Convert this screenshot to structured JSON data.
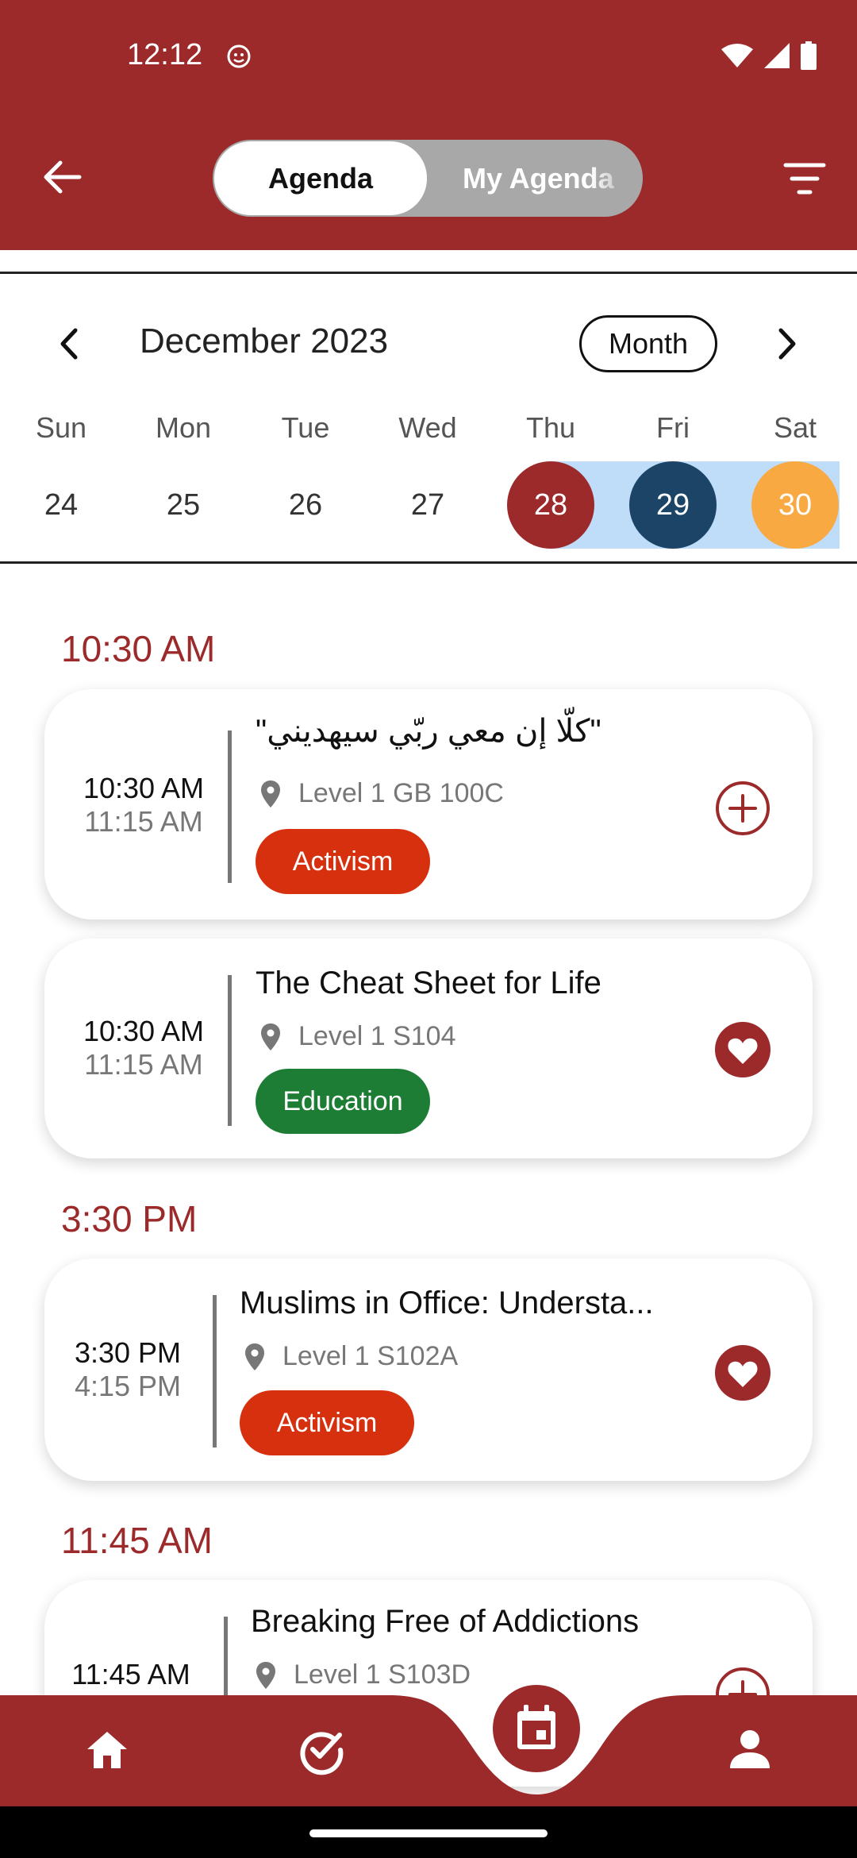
{
  "status_bar": {
    "time": "12:12"
  },
  "header": {
    "segment_active": "Agenda",
    "segment_inactive": "My Agenda"
  },
  "calendar": {
    "title": "December 2023",
    "view_button": "Month",
    "weekdays": [
      "Sun",
      "Mon",
      "Tue",
      "Wed",
      "Thu",
      "Fri",
      "Sat"
    ],
    "days": [
      "24",
      "25",
      "26",
      "27",
      "28",
      "29",
      "30"
    ],
    "colors": {
      "thu": "#9c2a2b",
      "fri": "#1b4466",
      "sat": "#f9a942",
      "range": "#bfdcf9"
    }
  },
  "sections": [
    {
      "heading": "10:30 AM"
    },
    {
      "heading": "3:30 PM"
    },
    {
      "heading": "11:45 AM"
    }
  ],
  "sessions": [
    {
      "start": "10:30 AM",
      "end": "11:15 AM",
      "title": "\"كلّا إن معي ربّي سيهديني\"",
      "location": "Level 1 GB 100C",
      "tag": "Activism",
      "tag_color": "#d6300f",
      "action_icon": "add-circle-icon"
    },
    {
      "start": "10:30 AM",
      "end": "11:15 AM",
      "title": "The Cheat Sheet for Life",
      "location": "Level 1 S104",
      "tag": "Education",
      "tag_color": "#1e7d34",
      "action_icon": "heart-icon"
    },
    {
      "start": "3:30 PM",
      "end": "4:15 PM",
      "title": "Muslims in Office: Understa...",
      "location": "Level 1 S102A",
      "tag": "Activism",
      "tag_color": "#d6300f",
      "action_icon": "heart-icon"
    },
    {
      "start": "11:45 AM",
      "title": "Breaking Free of Addictions",
      "location": "Level 1 S103D",
      "action_icon": "add-circle-icon"
    }
  ],
  "theme": {
    "primary": "#9c2a2b"
  },
  "nav": {
    "items": [
      "home-icon",
      "check-circle-icon",
      "calendar-icon",
      "person-icon"
    ]
  }
}
